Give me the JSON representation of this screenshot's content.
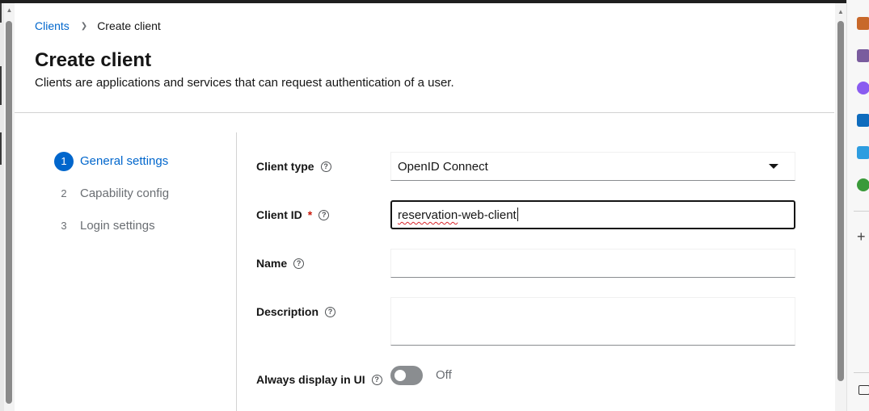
{
  "breadcrumb": {
    "parent": "Clients",
    "current": "Create client"
  },
  "header": {
    "title": "Create client",
    "description": "Clients are applications and services that can request authentication of a user."
  },
  "wizard": {
    "steps": [
      {
        "number": "1",
        "label": "General settings",
        "active": true
      },
      {
        "number": "2",
        "label": "Capability config",
        "active": false
      },
      {
        "number": "3",
        "label": "Login settings",
        "active": false
      }
    ]
  },
  "form": {
    "client_type": {
      "label": "Client type",
      "value": "OpenID Connect"
    },
    "client_id": {
      "label": "Client ID",
      "required_mark": "*",
      "value": "reservation-web-client",
      "misspelled_part": "reservation"
    },
    "name": {
      "label": "Name",
      "value": ""
    },
    "description": {
      "label": "Description",
      "value": ""
    },
    "always_display": {
      "label": "Always display in UI",
      "state": "Off"
    }
  },
  "colors": {
    "accent": "#0066cc",
    "required": "#c9190b",
    "toggle_off": "#8a8d90"
  },
  "icons": {
    "help": "?",
    "breadcrumb_separator": "❯",
    "scroll_up": "▲"
  }
}
